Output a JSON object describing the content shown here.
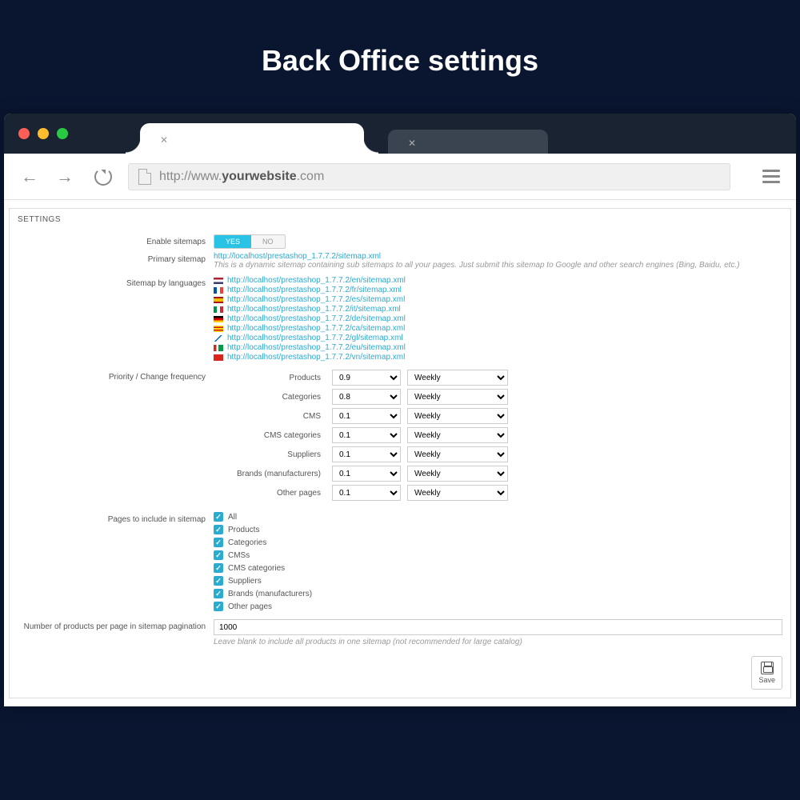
{
  "hero": {
    "title": "Back Office settings"
  },
  "url": {
    "prefix": "http://www.",
    "domain": "yourwebsite",
    "suffix": ".com"
  },
  "panel": {
    "title": "SETTINGS"
  },
  "form": {
    "enable_label": "Enable sitemaps",
    "enable_yes": "YES",
    "enable_no": "NO",
    "primary_label": "Primary sitemap",
    "primary_url": "http://localhost/prestashop_1.7.7.2/sitemap.xml",
    "primary_helper": "This is a dynamic sitemap containing sub sitemaps to all your pages. Just submit this sitemap to Google and other search engines (Bing, Baidu, etc.)",
    "languages_label": "Sitemap by languages",
    "languages": [
      {
        "flag": "us",
        "url": "http://localhost/prestashop_1.7.7.2/en/sitemap.xml"
      },
      {
        "flag": "fr",
        "url": "http://localhost/prestashop_1.7.7.2/fr/sitemap.xml"
      },
      {
        "flag": "es",
        "url": "http://localhost/prestashop_1.7.7.2/es/sitemap.xml"
      },
      {
        "flag": "it",
        "url": "http://localhost/prestashop_1.7.7.2/it/sitemap.xml"
      },
      {
        "flag": "de",
        "url": "http://localhost/prestashop_1.7.7.2/de/sitemap.xml"
      },
      {
        "flag": "ca",
        "url": "http://localhost/prestashop_1.7.7.2/ca/sitemap.xml"
      },
      {
        "flag": "gl",
        "url": "http://localhost/prestashop_1.7.7.2/gl/sitemap.xml"
      },
      {
        "flag": "eu",
        "url": "http://localhost/prestashop_1.7.7.2/eu/sitemap.xml"
      },
      {
        "flag": "vn",
        "url": "http://localhost/prestashop_1.7.7.2/vn/sitemap.xml"
      }
    ],
    "priority_label": "Priority / Change frequency",
    "freq_rows": [
      {
        "label": "Products",
        "priority": "0.9",
        "freq": "Weekly"
      },
      {
        "label": "Categories",
        "priority": "0.8",
        "freq": "Weekly"
      },
      {
        "label": "CMS",
        "priority": "0.1",
        "freq": "Weekly"
      },
      {
        "label": "CMS categories",
        "priority": "0.1",
        "freq": "Weekly"
      },
      {
        "label": "Suppliers",
        "priority": "0.1",
        "freq": "Weekly"
      },
      {
        "label": "Brands (manufacturers)",
        "priority": "0.1",
        "freq": "Weekly"
      },
      {
        "label": "Other pages",
        "priority": "0.1",
        "freq": "Weekly"
      }
    ],
    "pages_label": "Pages to include in sitemap",
    "pages": [
      "All",
      "Products",
      "Categories",
      "CMSs",
      "CMS categories",
      "Suppliers",
      "Brands (manufacturers)",
      "Other pages"
    ],
    "pagination_label": "Number of products per page in sitemap pagination",
    "pagination_value": "1000",
    "pagination_helper": "Leave blank to include all products in one sitemap (not recommended for large catalog)",
    "save_label": "Save"
  },
  "flags": {
    "us": "linear-gradient(#b22234 33%, #fff 33% 66%, #3c3b6e 66%)",
    "fr": "linear-gradient(90deg, #0055a4 33%, #fff 33% 66%, #ef4135 66%)",
    "es": "linear-gradient(#aa151b 25%, #f1bf00 25% 75%, #aa151b 75%)",
    "it": "linear-gradient(90deg, #009246 33%, #fff 33% 66%, #ce2b37 66%)",
    "de": "linear-gradient(#000 33%, #dd0000 33% 66%, #ffce00 66%)",
    "ca": "linear-gradient(#fcdd09 20%, #da121a 20% 40%, #fcdd09 40% 60%, #da121a 60% 80%, #fcdd09 80%)",
    "gl": "linear-gradient(135deg, #fff 45%, #0066cc 45% 55%, #fff 55%)",
    "eu": "linear-gradient(90deg, #d52b1e 30%, #fff 30% 50%, #009b48 50%)",
    "vn": "#da251d"
  }
}
